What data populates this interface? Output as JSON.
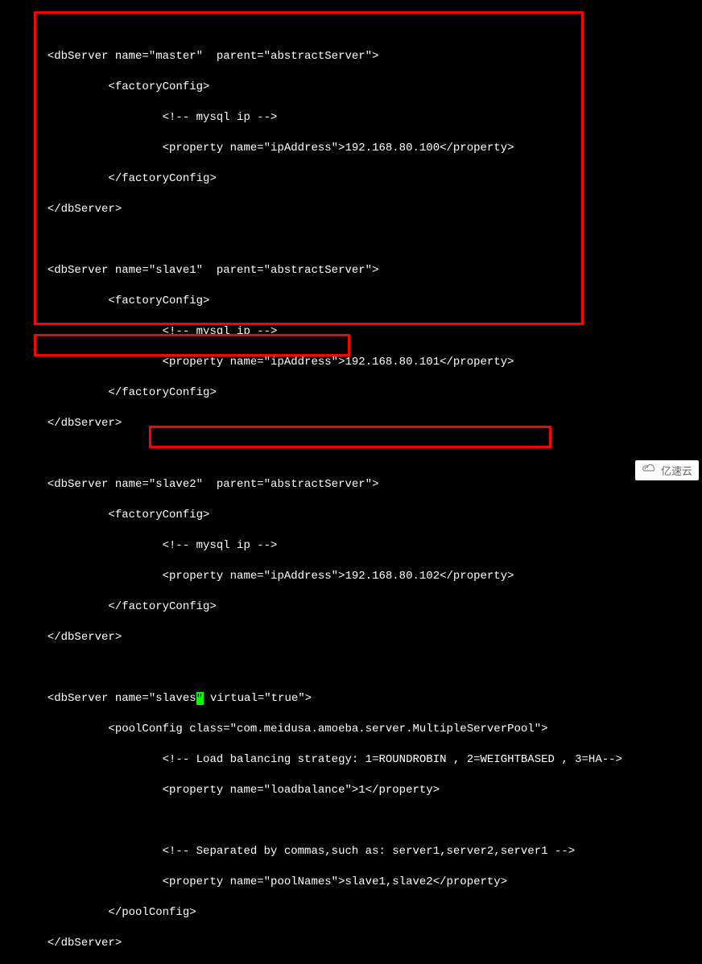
{
  "code": {
    "lines": [
      "",
      "       <dbServer name=\"master\"  parent=\"abstractServer\">",
      "                <factoryConfig>",
      "                        <!-- mysql ip -->",
      "                        <property name=\"ipAddress\">192.168.80.100</property>",
      "                </factoryConfig>",
      "       </dbServer>",
      "",
      "       <dbServer name=\"slave1\"  parent=\"abstractServer\">",
      "                <factoryConfig>",
      "                        <!-- mysql ip -->",
      "                        <property name=\"ipAddress\">192.168.80.101</property>",
      "                </factoryConfig>",
      "       </dbServer>",
      "",
      "       <dbServer name=\"slave2\"  parent=\"abstractServer\">",
      "                <factoryConfig>",
      "                        <!-- mysql ip -->",
      "                        <property name=\"ipAddress\">192.168.80.102</property>",
      "                </factoryConfig>",
      "       </dbServer>",
      ""
    ],
    "cursor_line_pre": "       <dbServer name=\"slaves",
    "cursor_line_post": " virtual=\"true\">",
    "lines2": [
      "                <poolConfig class=\"com.meidusa.amoeba.server.MultipleServerPool\">",
      "                        <!-- Load balancing strategy: 1=ROUNDROBIN , 2=WEIGHTBASED , 3=HA-->",
      "                        <property name=\"loadbalance\">1</property>",
      "",
      "                        <!-- Separated by commas,such as: server1,server2,server1 -->",
      "                        <property name=\"poolNames\">slave1,slave2</property>",
      "                </poolConfig>",
      "       </dbServer>"
    ]
  },
  "watermark": {
    "text": "亿速云"
  },
  "chart_data": {
    "type": "table",
    "title": "dbServer XML configuration blocks",
    "servers": [
      {
        "name": "master",
        "parent": "abstractServer",
        "ipAddress": "192.168.80.100"
      },
      {
        "name": "slave1",
        "parent": "abstractServer",
        "ipAddress": "192.168.80.101"
      },
      {
        "name": "slave2",
        "parent": "abstractServer",
        "ipAddress": "192.168.80.102"
      },
      {
        "name": "slaves",
        "virtual": "true",
        "poolConfig": {
          "class": "com.meidusa.amoeba.server.MultipleServerPool",
          "loadbalance": "1",
          "poolNames": "slave1,slave2"
        }
      }
    ]
  }
}
